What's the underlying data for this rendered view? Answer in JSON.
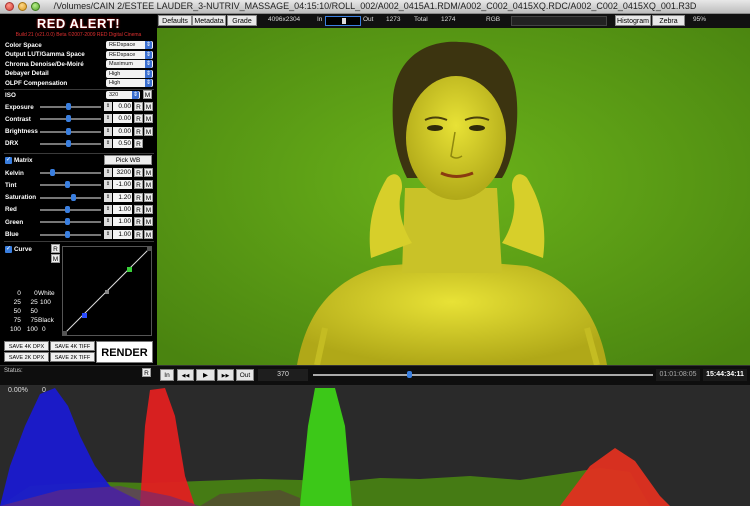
{
  "window": {
    "title": "/Volumes/CAIN 2/ESTEE LAUDER_3-NUTRIV_MASSAGE_04:15:10/ROLL_002/A002_0415A1.RDM/A002_C002_0415XQ.RDC/A002_C002_0415XQ_001.R3D"
  },
  "app": {
    "name": "RED ALERT!",
    "build": "Build 21 (v21.0.0) Beta ©2007-2009 RED Digital Cinema"
  },
  "colorspace": [
    {
      "label": "Color Space",
      "value": "REDspace"
    },
    {
      "label": "Output LUT/Gamma Space",
      "value": "REDspace"
    },
    {
      "label": "Chroma Denoise/De-Moiré",
      "value": "Maximum"
    },
    {
      "label": "Debayer Detail",
      "value": "High"
    },
    {
      "label": "OLPF Compensation",
      "value": "High"
    }
  ],
  "iso": {
    "label": "ISO",
    "value": "320",
    "btn": "M"
  },
  "adjust": [
    {
      "label": "Exposure",
      "value": "0.00",
      "knob": 0.47
    },
    {
      "label": "Contrast",
      "value": "0.00",
      "knob": 0.47
    },
    {
      "label": "Brightness",
      "value": "0.00",
      "knob": 0.47
    },
    {
      "label": "DRX",
      "value": "0.50",
      "knob": 0.47
    }
  ],
  "matrix": {
    "label": "Matrix",
    "pick": "Pick WB"
  },
  "matrix_rows": [
    {
      "label": "Kelvin",
      "value": "3200",
      "knob": 0.18
    },
    {
      "label": "Tint",
      "value": "-1.00",
      "knob": 0.45
    },
    {
      "label": "Saturation",
      "value": "1.20",
      "knob": 0.55
    },
    {
      "label": "Red",
      "value": "1.00",
      "knob": 0.45
    },
    {
      "label": "Green",
      "value": "1.00",
      "knob": 0.45
    },
    {
      "label": "Blue",
      "value": "1.00",
      "knob": 0.45
    }
  ],
  "buttons": {
    "r": "R",
    "m": "M"
  },
  "curve": {
    "label": "Curve",
    "table": [
      [
        "0",
        "0"
      ],
      [
        "25",
        "25"
      ],
      [
        "50",
        "50"
      ],
      [
        "75",
        "75"
      ],
      [
        "100",
        "100"
      ]
    ],
    "white_label": "White",
    "white_value": "100",
    "black_label": "Black",
    "black_value": "0"
  },
  "save": {
    "dpx4k": "SAVE 4K DPX",
    "tiff4k": "SAVE 4K TIFF",
    "dpx2k": "SAVE 2K DPX",
    "tiff2k": "SAVE 2K TIFF",
    "render": "RENDER"
  },
  "status": {
    "label": "Status:",
    "r": "R"
  },
  "topbar": {
    "defaults": "Defaults",
    "metadata": "Metadata",
    "grade": "Grade",
    "resolution": "4096x2304",
    "in_label": "In",
    "out_label": "Out",
    "out_value": "1273",
    "total_label": "Total",
    "total_value": "1274",
    "rgb_label": "RGB",
    "histogram": "Histogram",
    "zebra": "Zebra",
    "zoom": "95%"
  },
  "transport": {
    "in": "In",
    "prev": "◀◀",
    "play": "▶",
    "next": "▶▶",
    "out": "Out",
    "frame": "370",
    "scrub_position": 0.28,
    "timecode1": "01:01:08:05",
    "timecode2": "15:44:34:11"
  },
  "histogram": {
    "percent": "0.00%",
    "zero": "0"
  },
  "colors": {
    "accent": "#3a7fe0",
    "backdrop": "#5a9a12",
    "red": "#e03030"
  }
}
